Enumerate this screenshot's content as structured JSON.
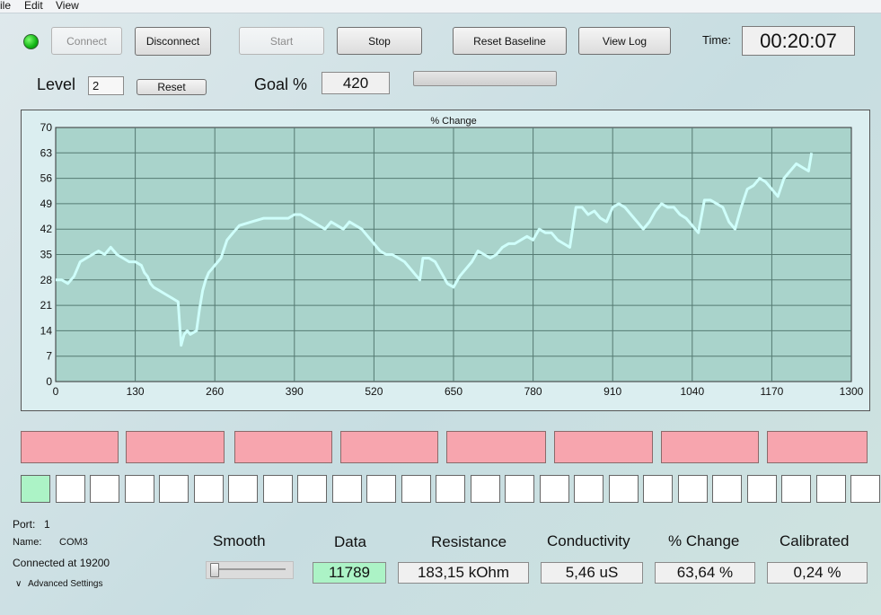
{
  "menu": {
    "file": "ile",
    "edit": "Edit",
    "view": "View"
  },
  "toolbar": {
    "connect": "Connect",
    "disconnect": "Disconnect",
    "start": "Start",
    "stop": "Stop",
    "reset_baseline": "Reset Baseline",
    "view_log": "View Log",
    "time_label": "Time:",
    "time_value": "00:20:07"
  },
  "level": {
    "label": "Level",
    "value": "2",
    "reset": "Reset"
  },
  "goal": {
    "label": "Goal %",
    "value": "420",
    "progress": 0
  },
  "colors": {
    "plot_bg": "#a9d3cb",
    "line": "#cffffb",
    "indicator_red": "#f7a5ae",
    "indicator_green": "#acf3c6"
  },
  "chart_data": {
    "type": "line",
    "title": "% Change",
    "xlim": [
      0,
      1300
    ],
    "ylim": [
      0,
      70
    ],
    "x_ticks": [
      0,
      130,
      260,
      390,
      520,
      650,
      780,
      910,
      1040,
      1170,
      1300
    ],
    "y_ticks": [
      0,
      7,
      14,
      21,
      28,
      35,
      42,
      49,
      56,
      63,
      70
    ],
    "grid": true,
    "series": [
      {
        "x": [
          0,
          10,
          20,
          30,
          35,
          40,
          50,
          60,
          70,
          80,
          90,
          100,
          110,
          120,
          130,
          140,
          145,
          150,
          155,
          160,
          170,
          180,
          190,
          200,
          205,
          210,
          215,
          220,
          230,
          235,
          240,
          245,
          250,
          255,
          260,
          270,
          280,
          290,
          300,
          320,
          340,
          360,
          380,
          390,
          400,
          410,
          420,
          430,
          440,
          450,
          460,
          470,
          480,
          490,
          500,
          510,
          520,
          530,
          540,
          550,
          560,
          570,
          580,
          590,
          595,
          600,
          610,
          620,
          630,
          640,
          650,
          660,
          670,
          680,
          690,
          700,
          710,
          720,
          730,
          740,
          750,
          760,
          770,
          780,
          790,
          800,
          810,
          820,
          830,
          840,
          850,
          860,
          870,
          880,
          890,
          900,
          910,
          920,
          930,
          940,
          950,
          960,
          970,
          980,
          990,
          1000,
          1010,
          1020,
          1030,
          1040,
          1045,
          1050,
          1060,
          1070,
          1080,
          1090,
          1100,
          1110,
          1120,
          1130,
          1140,
          1150,
          1160,
          1170,
          1180,
          1190,
          1200,
          1210,
          1220,
          1230,
          1235
        ],
        "y": [
          28,
          28,
          27,
          29,
          31,
          33,
          34,
          35,
          36,
          35,
          37,
          35,
          34,
          33,
          33,
          32,
          30,
          29,
          27,
          26,
          25,
          24,
          23,
          22,
          10,
          13,
          14,
          13,
          14,
          20,
          25,
          28,
          30,
          31,
          32,
          34,
          39,
          41,
          43,
          44,
          45,
          45,
          45,
          46,
          46,
          45,
          44,
          43,
          42,
          44,
          43,
          42,
          44,
          43,
          42,
          40,
          38,
          36,
          35,
          35,
          34,
          33,
          31,
          29,
          28,
          34,
          34,
          33,
          30,
          27,
          26,
          29,
          31,
          33,
          36,
          35,
          34,
          35,
          37,
          38,
          38,
          39,
          40,
          39,
          42,
          41,
          41,
          39,
          38,
          37,
          48,
          48,
          46,
          47,
          45,
          44,
          48,
          49,
          48,
          46,
          44,
          42,
          44,
          47,
          49,
          48,
          48,
          46,
          45,
          43,
          42,
          41,
          50,
          50,
          49,
          48,
          44,
          42,
          48,
          53,
          54,
          56,
          55,
          53,
          51,
          56,
          58,
          60,
          59,
          58,
          63
        ]
      }
    ]
  },
  "indicators": {
    "red_count": 8,
    "squares_count": 25,
    "squares_lit": [
      0
    ]
  },
  "port_info": {
    "port_label": "Port:",
    "port_value": "1",
    "name_label": "Name:",
    "name_value": "COM3",
    "connected": "Connected at 19200",
    "advanced": "Advanced Settings"
  },
  "readouts": {
    "smooth_label": "Smooth",
    "smooth_value": 0,
    "data_label": "Data",
    "data_value": "11789",
    "resistance_label": "Resistance",
    "resistance_value": "183,15 kOhm",
    "conductivity_label": "Conductivity",
    "conductivity_value": "5,46 uS",
    "change_label": "% Change",
    "change_value": "63,64 %",
    "calibrated_label": "Calibrated",
    "calibrated_value": "0,24 %"
  }
}
